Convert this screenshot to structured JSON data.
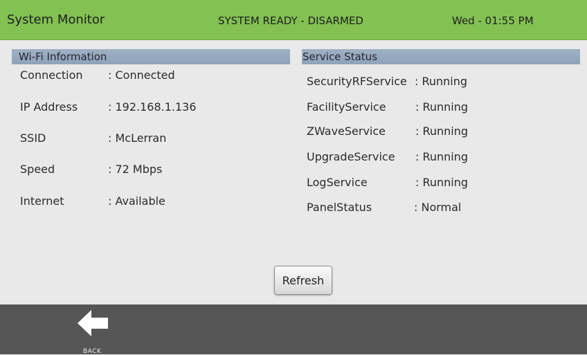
{
  "header": {
    "title": "System Monitor",
    "system_status": "SYSTEM READY - DISARMED",
    "datetime": "Wed - 01:55 PM"
  },
  "wifi": {
    "heading": "Wi-Fi Information",
    "rows": [
      {
        "label": "Connection",
        "value": ": Connected"
      },
      {
        "label": "IP Address",
        "value": ": 192.168.1.136"
      },
      {
        "label": "SSID",
        "value": ": McLerran"
      },
      {
        "label": "Speed",
        "value": ": 72 Mbps"
      },
      {
        "label": "Internet",
        "value": ": Available"
      }
    ]
  },
  "services": {
    "heading": "Service Status",
    "rows": [
      {
        "label": "SecurityRFService",
        "value": ": Running"
      },
      {
        "label": "FacilityService",
        "value": ": Running"
      },
      {
        "label": "ZWaveService",
        "value": ": Running"
      },
      {
        "label": "UpgradeService",
        "value": ": Running"
      },
      {
        "label": "LogService",
        "value": ": Running"
      },
      {
        "label": "PanelStatus",
        "value": ": Normal"
      }
    ]
  },
  "actions": {
    "refresh_label": "Refresh"
  },
  "footer": {
    "back_label": "BACK",
    "back_icon": "arrow-left-icon"
  },
  "colors": {
    "header_bg": "#82c152",
    "panel_head_bg": "#9fb0c4",
    "footer_bg": "#565656"
  }
}
